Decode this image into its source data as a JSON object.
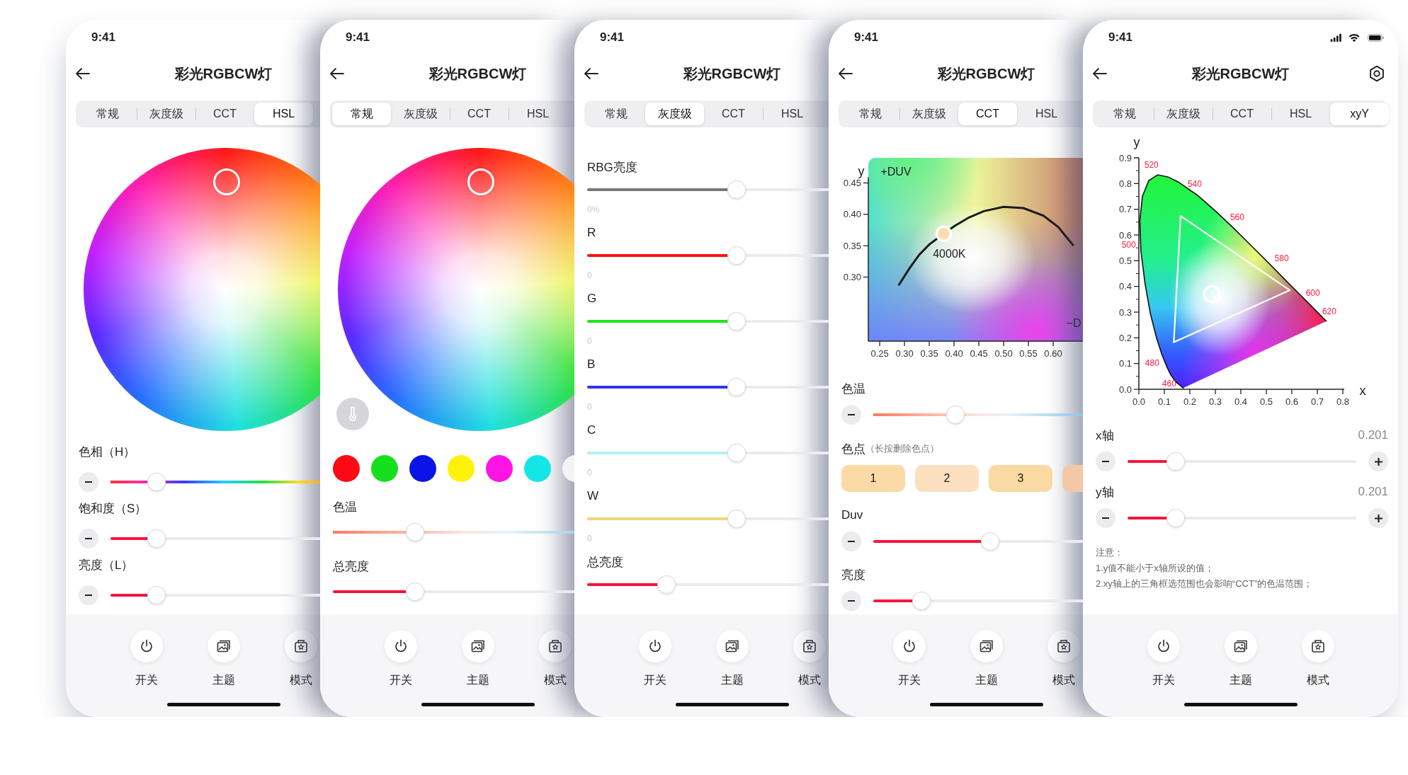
{
  "phones": [
    {
      "kind": "hsl",
      "time": "9:41",
      "title": "彩光RGBCW灯",
      "tabs": [
        {
          "label": "常规",
          "selected": false
        },
        {
          "label": "灰度级",
          "selected": false
        },
        {
          "label": "CCT",
          "selected": false
        },
        {
          "label": "HSL",
          "selected": true
        }
      ],
      "sections": [
        {
          "kind": "wheel"
        },
        {
          "kind": "hue_slider",
          "label": "色相（H）",
          "level": 0.2,
          "minus": true
        },
        {
          "kind": "fill_slider",
          "label": "饱和度（S）",
          "level": 0.2,
          "minus": true
        },
        {
          "kind": "fill_slider",
          "label": "亮度（L）",
          "level": 0.2,
          "minus": true
        }
      ],
      "nav": [
        {
          "label": "开关"
        },
        {
          "label": "主题"
        },
        {
          "label": "模式"
        }
      ]
    },
    {
      "kind": "basic",
      "time": "9:41",
      "title": "彩光RGBCW灯",
      "tabs": [
        {
          "label": "常规",
          "selected": true
        },
        {
          "label": "灰度级",
          "selected": false
        },
        {
          "label": "CCT",
          "selected": false
        },
        {
          "label": "HSL",
          "selected": false
        }
      ],
      "sections": [
        {
          "kind": "wheel",
          "temperature_button": true
        },
        {
          "kind": "swatches",
          "swatches": [
            {
              "color": "#ff0a14"
            },
            {
              "color": "#16e01e"
            },
            {
              "color": "#0a14e6"
            },
            {
              "color": "#fff20a"
            },
            {
              "color": "#ff14e6"
            },
            {
              "color": "#14e6e6"
            },
            {
              "color": "#f4f4f4"
            }
          ]
        },
        {
          "kind": "temperature_slider",
          "label": "色温",
          "level": 0.28
        },
        {
          "kind": "fill_slider",
          "label": "总亮度",
          "level": 0.28
        }
      ],
      "nav": [
        {
          "label": "开关"
        },
        {
          "label": "主题"
        },
        {
          "label": "模式"
        }
      ]
    },
    {
      "kind": "gray",
      "time": "9:41",
      "title": "彩光RGBCW灯",
      "tabs": [
        {
          "label": "常规",
          "selected": false
        },
        {
          "label": "灰度级",
          "selected": true
        },
        {
          "label": "CCT",
          "selected": false
        },
        {
          "label": "HSL",
          "selected": false
        }
      ],
      "sections": [
        {
          "kind": "fill_slider",
          "label": "RBG亮度",
          "color": "#777777",
          "level": 0.51,
          "reading": "0%"
        },
        {
          "kind": "fill_slider",
          "label": "R",
          "color": "#ff0f0f",
          "level": 0.51,
          "reading": "0"
        },
        {
          "kind": "fill_slider",
          "label": "G",
          "color": "#1ee61e",
          "level": 0.51,
          "reading": "0"
        },
        {
          "kind": "fill_slider",
          "label": "B",
          "color": "#3434e6",
          "level": 0.51,
          "reading": "0"
        },
        {
          "kind": "fill_slider",
          "label": "C",
          "color": "#b4f2f0",
          "level": 0.51,
          "reading": "0"
        },
        {
          "kind": "fill_slider",
          "label": "W",
          "color": "#f1d67c",
          "level": 0.51,
          "reading": "0"
        },
        {
          "kind": "fill_slider",
          "label": "总亮度",
          "level": 0.27
        }
      ],
      "nav": [
        {
          "label": "开关"
        },
        {
          "label": "主题"
        },
        {
          "label": "模式"
        }
      ]
    },
    {
      "kind": "cct",
      "time": "9:41",
      "title": "彩光RGBCW灯",
      "tabs": [
        {
          "label": "常规",
          "selected": false
        },
        {
          "label": "灰度级",
          "selected": false
        },
        {
          "label": "CCT",
          "selected": true
        },
        {
          "label": "HSL",
          "selected": false
        }
      ],
      "sections": [
        {
          "kind": "cct_chart",
          "chart_data": {
            "type": "line",
            "ylabel": "y",
            "xlim": [
              0.227,
              0.66
            ],
            "ylim": [
              0.198,
              0.49
            ],
            "xticks": [
              {
                "value": 0.25,
                "label": "0.25"
              },
              {
                "value": 0.3,
                "label": "0.30"
              },
              {
                "value": 0.35,
                "label": "0.35"
              },
              {
                "value": 0.4,
                "label": "0.40"
              },
              {
                "value": 0.45,
                "label": "0.45"
              },
              {
                "value": 0.5,
                "label": "0.50"
              },
              {
                "value": 0.55,
                "label": "0.55"
              },
              {
                "value": 0.6,
                "label": "0.60"
              }
            ],
            "yticks": [
              {
                "value": 0.3,
                "label": "0.30"
              },
              {
                "value": 0.35,
                "label": "0.35"
              },
              {
                "value": 0.4,
                "label": "0.40"
              },
              {
                "value": 0.45,
                "label": "0.45"
              }
            ],
            "x": [
              0.289,
              0.31,
              0.33,
              0.35,
              0.379,
              0.4,
              0.43,
              0.46,
              0.5,
              0.54,
              0.58,
              0.61,
              0.64
            ],
            "series": [
              {
                "color": "#1a1a1a",
                "values": [
                  0.288,
                  0.314,
                  0.336,
                  0.352,
                  0.369,
                  0.381,
                  0.395,
                  0.405,
                  0.412,
                  0.41,
                  0.398,
                  0.38,
                  0.351
                ]
              }
            ],
            "annotations": [
              "+DUV",
              "−D",
              {
                "text": "4000K",
                "x": 0.379,
                "y": 0.369
              }
            ]
          }
        },
        {
          "kind": "temperature_slider",
          "label": "色温",
          "level": 0.36,
          "minus": true
        },
        {
          "kind": "chips",
          "label": "色点",
          "hint": "（长按删除色点）",
          "chips": [
            {
              "label": "1",
              "color": "#fbdaa6"
            },
            {
              "label": "2",
              "color": "#fce0c0"
            },
            {
              "label": "3",
              "color": "#fad9a2"
            },
            {
              "color": "#f3c8a8"
            }
          ]
        },
        {
          "kind": "fill_slider",
          "label": "Duv",
          "level": 0.51,
          "minus": true
        },
        {
          "kind": "fill_slider",
          "label": "亮度",
          "level": 0.21,
          "minus": true
        }
      ],
      "nav": [
        {
          "label": "开关"
        },
        {
          "label": "主题"
        },
        {
          "label": "模式"
        }
      ]
    },
    {
      "kind": "xyy",
      "time": "9:41",
      "title": "彩光RGBCW灯",
      "status_icons": true,
      "settings": true,
      "tabs": [
        {
          "label": "常规",
          "selected": false
        },
        {
          "label": "灰度级",
          "selected": false
        },
        {
          "label": "CCT",
          "selected": false
        },
        {
          "label": "HSL",
          "selected": false
        },
        {
          "label": "xyY",
          "selected": true
        }
      ],
      "sections": [
        {
          "kind": "cie_chart",
          "chart_data": {
            "type": "line",
            "xlabel": "x",
            "ylabel": "y",
            "xlim": [
              0,
              0.8
            ],
            "ylim": [
              0,
              0.9
            ],
            "xticks": [
              {
                "value": 0,
                "label": "0.0"
              },
              {
                "value": 0.1,
                "label": "0.1"
              },
              {
                "value": 0.2,
                "label": "0.2"
              },
              {
                "value": 0.3,
                "label": "0.3"
              },
              {
                "value": 0.4,
                "label": "0.4"
              },
              {
                "value": 0.5,
                "label": "0.5"
              },
              {
                "value": 0.6,
                "label": "0.6"
              },
              {
                "value": 0.7,
                "label": "0.7"
              },
              {
                "value": 0.8,
                "label": "0.8"
              }
            ],
            "yticks": [
              {
                "value": 0,
                "label": "0.0"
              },
              {
                "value": 0.1,
                "label": "0.1"
              },
              {
                "value": 0.2,
                "label": "0.2"
              },
              {
                "value": 0.3,
                "label": "0.3"
              },
              {
                "value": 0.4,
                "label": "0.4"
              },
              {
                "value": 0.5,
                "label": "0.5"
              },
              {
                "value": 0.6,
                "label": "0.6"
              },
              {
                "value": 0.7,
                "label": "0.7"
              },
              {
                "value": 0.8,
                "label": "0.8"
              },
              {
                "value": 0.9,
                "label": "0.9"
              }
            ],
            "x": [
              0.174,
              0.144,
              0.124,
              0.11,
              0.091,
              0.069,
              0.045,
              0.024,
              0.008,
              0.004,
              0.014,
              0.039,
              0.074,
              0.114,
              0.155,
              0.23,
              0.302,
              0.373,
              0.444,
              0.513,
              0.575,
              0.627,
              0.666,
              0.692,
              0.719,
              0.735
            ],
            "series": [
              {
                "color": "#111111",
                "values": [
                  0.005,
                  0.03,
                  0.058,
                  0.087,
                  0.133,
                  0.201,
                  0.295,
                  0.413,
                  0.538,
                  0.655,
                  0.75,
                  0.812,
                  0.834,
                  0.826,
                  0.806,
                  0.754,
                  0.692,
                  0.625,
                  0.555,
                  0.487,
                  0.424,
                  0.373,
                  0.334,
                  0.308,
                  0.281,
                  0.265
                ]
              }
            ],
            "annotations": [
              {
                "text": "520",
                "x": 0.074,
                "y": 0.834
              },
              {
                "text": "540",
                "x": 0.23,
                "y": 0.754
              },
              {
                "text": "560",
                "x": 0.373,
                "y": 0.625
              },
              {
                "text": "580",
                "x": 0.513,
                "y": 0.487
              },
              {
                "text": "600",
                "x": 0.627,
                "y": 0.373
              },
              {
                "text": "620",
                "x": 0.692,
                "y": 0.308
              },
              {
                "text": "500",
                "x": 0.008,
                "y": 0.538
              },
              {
                "text": "480",
                "x": 0.091,
                "y": 0.133
              },
              {
                "text": "460",
                "x": 0.144,
                "y": 0.03
              }
            ]
          }
        },
        {
          "kind": "fill_slider",
          "label": "x轴",
          "level": 0.21,
          "value": "0.201",
          "minus": true,
          "plus": true
        },
        {
          "kind": "fill_slider",
          "label": "y轴",
          "level": 0.21,
          "value": "0.201",
          "minus": true,
          "plus": true
        },
        {
          "kind": "notes",
          "lines": [
            "注意：",
            "1.y值不能小于x轴所设的值；",
            "2.xy轴上的三角框选范围也会影响“CCT”的色温范围；"
          ]
        }
      ],
      "nav": [
        {
          "label": "开关"
        },
        {
          "label": "主题"
        },
        {
          "label": "模式"
        }
      ]
    }
  ]
}
